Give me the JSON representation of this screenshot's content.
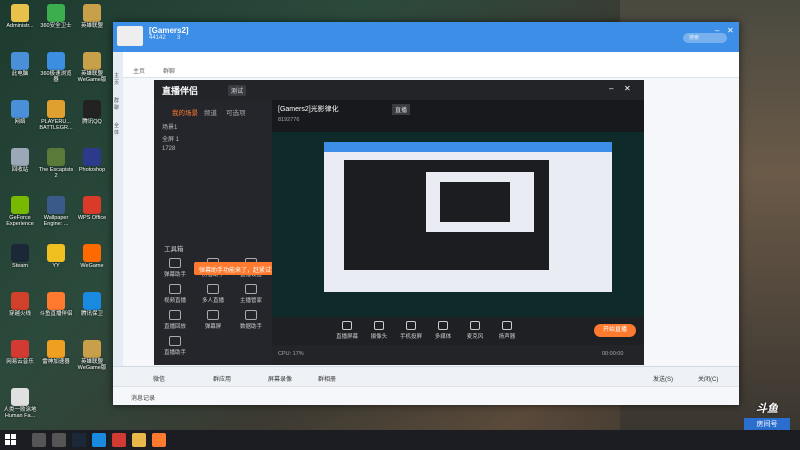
{
  "desktop": {
    "icons": [
      {
        "label": "Administr...",
        "color": "#e8c14a"
      },
      {
        "label": "360安全卫士",
        "color": "#3cae4e"
      },
      {
        "label": "英雄联盟",
        "color": "#c8a04a"
      },
      {
        "label": "此电脑",
        "color": "#4a90d9"
      },
      {
        "label": "360极速浏览器",
        "color": "#3c8fe0"
      },
      {
        "label": "英雄联盟WeGame版",
        "color": "#c8a04a"
      },
      {
        "label": "网络",
        "color": "#4a90d9"
      },
      {
        "label": "PLAYERU... BATTLEGR...",
        "color": "#e0a030"
      },
      {
        "label": "腾讯QQ",
        "color": "#222222"
      },
      {
        "label": "回收站",
        "color": "#9aa8b8"
      },
      {
        "label": "The Escapists 2",
        "color": "#5a7a3a"
      },
      {
        "label": "Photoshop",
        "color": "#2b3a8a"
      },
      {
        "label": "GeForce Experience",
        "color": "#76b900"
      },
      {
        "label": "Wallpaper Engine: ...",
        "color": "#3a5a8a"
      },
      {
        "label": "WPS Office",
        "color": "#d93a2a"
      },
      {
        "label": "Steam",
        "color": "#1b2838"
      },
      {
        "label": "YY",
        "color": "#f0c020"
      },
      {
        "label": "WeGame",
        "color": "#ff6a00"
      },
      {
        "label": "穿越火线",
        "color": "#d0402a"
      },
      {
        "label": "斗鱼直播伴侣",
        "color": "#ff7a2e"
      },
      {
        "label": "腾讯保卫",
        "color": "#1a8ae0"
      },
      {
        "label": "网易云音乐",
        "color": "#d33a31"
      },
      {
        "label": "雷神加速器",
        "color": "#f0a020"
      },
      {
        "label": "英雄联盟WeGame版",
        "color": "#c8a04a"
      },
      {
        "label": "人类一败涂地 Human Fa...",
        "color": "#e0e0e0"
      }
    ]
  },
  "qq_window": {
    "group_name": "[Gamers2]",
    "member_count": "44142",
    "online_count": "3",
    "search_placeholder": "搜索",
    "sub_items": [
      "主页",
      "群聊"
    ],
    "bottom_tools": [
      "微信",
      "群应用",
      "屏幕录像",
      "群相册"
    ],
    "send_label": "发送(S)",
    "close_label": "关闭(C)",
    "footer_text": "消息记录",
    "side_labels": [
      "主页",
      "群聊",
      "全体"
    ]
  },
  "stream_app": {
    "logo": "直播伴侣",
    "version_badge": "测试",
    "sidebar_tabs": [
      "我的场景",
      "频道",
      "可选项"
    ],
    "scenes": [
      "场景1",
      "全屏 1",
      "1728"
    ],
    "tools_label": "工具箱",
    "tools": [
      "弹幕助手",
      "房管助手",
      "直播设置",
      "视频直播",
      "多人直播",
      "主播管家",
      "直播回放",
      "弹幕屏",
      "数据助手",
      "直播助手"
    ],
    "tooltip": "弹幕助手功能来了，赶紧试试吧~",
    "room_title": "[Gamers2]光影律化",
    "room_tag": "直播",
    "room_sub": "8192776",
    "controls": [
      "直播屏幕",
      "摄像头",
      "手机投屏",
      "多媒体",
      "麦克风",
      "扬声器"
    ],
    "go_live": "开始直播",
    "status_left": "CPU: 17%",
    "status_right": "00:00:00"
  },
  "watermark": {
    "brand": "斗鱼",
    "room_label": "房间号",
    "room_number": "8192776"
  },
  "taskbar": {
    "apps": [
      "search",
      "task-view",
      "steam",
      "qq",
      "netease",
      "explorer",
      "stream"
    ]
  }
}
